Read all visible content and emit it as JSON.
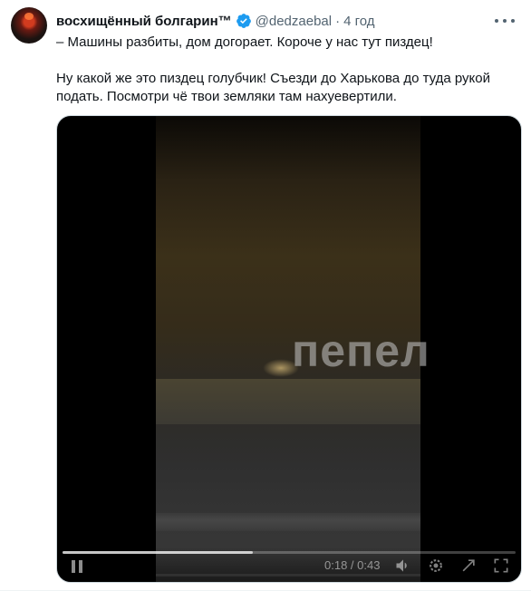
{
  "tweet": {
    "author_name": "восхищённый болгарин™",
    "handle": "@dedzaebal",
    "separator": "·",
    "time": "4 год",
    "text_line1": "– Машины разбиты, дом догорает. Короче у нас тут пиздец!",
    "text_line2": "Ну какой же это пиздец голубчик! Съезди до Харькова до туда рукой подать. Посмотри чё твои земляки там нахуевертили."
  },
  "video": {
    "watermark": "пепел",
    "timecode": "0:18 / 0:43",
    "progress": 0.42,
    "icons": [
      "pause-icon",
      "volume-icon",
      "settings-icon",
      "fullscreen-icon",
      "expand-icon"
    ]
  },
  "colors": {
    "text": "#0f1419",
    "secondary": "#536471",
    "verified": "#1d9bf0"
  }
}
